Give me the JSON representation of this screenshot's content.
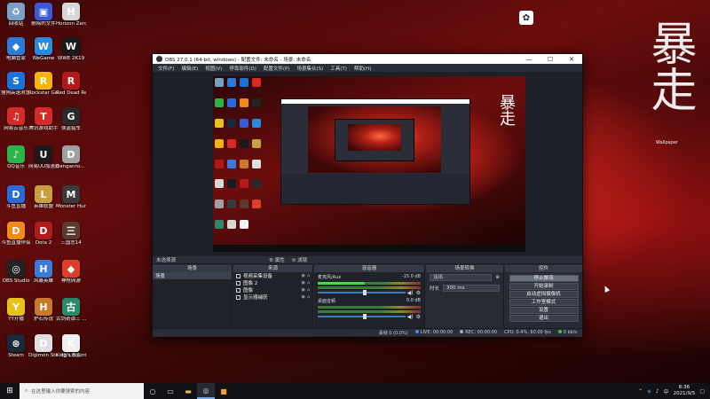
{
  "desktop": {
    "icons": [
      {
        "label": "回收站",
        "icon": "recycle-bin-icon",
        "color": "#7aa0c8",
        "glyph": "♻"
      },
      {
        "label": "电脑管家",
        "icon": "shield-icon",
        "color": "#2a7ad8",
        "glyph": "◆"
      },
      {
        "label": "搜狗高速浏览器",
        "icon": "browser-icon",
        "color": "#1a73d8",
        "glyph": "S"
      },
      {
        "label": "网易云音乐",
        "icon": "netease-music-icon",
        "color": "#d42a2a",
        "glyph": "♫"
      },
      {
        "label": "QQ音乐",
        "icon": "qq-music-icon",
        "color": "#2cb34a",
        "glyph": "♪"
      },
      {
        "label": "斗鱼直播",
        "icon": "douyu-icon",
        "color": "#2a6ad8",
        "glyph": "D"
      },
      {
        "label": "斗鱼直播伴侣",
        "icon": "douyu-companion-icon",
        "color": "#f08a1a",
        "glyph": "D"
      },
      {
        "label": "OBS Studio",
        "icon": "obs-icon",
        "color": "#222222",
        "glyph": "◎"
      },
      {
        "label": "YY开播",
        "icon": "yy-icon",
        "color": "#e8c21a",
        "glyph": "Y"
      },
      {
        "label": "Steam",
        "icon": "steam-icon",
        "color": "#1b2838",
        "glyph": "⊛"
      },
      {
        "label": "删除的文件",
        "icon": "folder-icon",
        "color": "#3a5ad8",
        "glyph": "▣"
      },
      {
        "label": "WeGame",
        "icon": "wegame-icon",
        "color": "#2a8ae0",
        "glyph": "W"
      },
      {
        "label": "Rockstar Games...",
        "icon": "rockstar-icon",
        "color": "#f5b400",
        "glyph": "R"
      },
      {
        "label": "腾讯游戏助手",
        "icon": "tencent-icon",
        "color": "#d42a2a",
        "glyph": "T"
      },
      {
        "label": "网易UU加速器",
        "icon": "uu-icon",
        "color": "#1a1a1a",
        "glyph": "U"
      },
      {
        "label": "英雄联盟",
        "icon": "lol-icon",
        "color": "#c8a040",
        "glyph": "L"
      },
      {
        "label": "Dota 2",
        "icon": "dota-icon",
        "color": "#b01a1a",
        "glyph": "D"
      },
      {
        "label": "风暴英雄",
        "icon": "hots-icon",
        "color": "#3a7ad8",
        "glyph": "H"
      },
      {
        "label": "炉石传说",
        "icon": "hearthstone-icon",
        "color": "#c87a2a",
        "glyph": "H"
      },
      {
        "label": "Digimon Story Cyb...",
        "icon": "digimon-icon",
        "color": "#e0e0e0",
        "glyph": "D"
      },
      {
        "label": "Horizon Zero Dawn",
        "icon": "horizon-icon",
        "color": "#d8d8d8",
        "glyph": "H"
      },
      {
        "label": "WWE 2K19",
        "icon": "wwe-icon",
        "color": "#1a1a1a",
        "glyph": "W"
      },
      {
        "label": "Red Dead Redempti...",
        "icon": "rdr-icon",
        "color": "#b01a1a",
        "glyph": "R"
      },
      {
        "label": "侠盗猎车",
        "icon": "gta-icon",
        "color": "#2a2a2a",
        "glyph": "G"
      },
      {
        "label": "Danganro... Trigger H...",
        "icon": "danganronpa-icon",
        "color": "#a0a0a0",
        "glyph": "D"
      },
      {
        "label": "Monster Hunter...",
        "icon": "monster-hunter-icon",
        "color": "#3a3a3a",
        "glyph": "M"
      },
      {
        "label": "三国志14",
        "icon": "sangokushi-icon",
        "color": "#5a3a2a",
        "glyph": "三"
      },
      {
        "label": "神枪网游",
        "icon": "game-icon",
        "color": "#d8402a",
        "glyph": "◆"
      },
      {
        "label": "古剑奇谭三 ...",
        "icon": "gujian-icon",
        "color": "#2a8a6a",
        "glyph": "古"
      },
      {
        "label": "超凡双生",
        "icon": "beyond-icon",
        "color": "#d8d8d8",
        "glyph": "B"
      },
      {
        "label": "King's Bounty II",
        "icon": "kings-bounty-icon",
        "color": "#f0f0f0",
        "glyph": "K"
      }
    ],
    "calligraphy": "暴走",
    "calligraphy_sub": "Wallpaper"
  },
  "obs": {
    "title": "OBS 27.0.1 (64-bit, windows) - 配置文件: 未命名 - 场景: 未命名",
    "menu": [
      "文件(F)",
      "编辑(E)",
      "视图(V)",
      "停靠部件(D)",
      "配置文件(P)",
      "场景集合(S)",
      "工具(T)",
      "帮助(H)"
    ],
    "scene_bar": {
      "label": "未选择源",
      "filters": [
        "属性",
        "滤镜"
      ]
    },
    "docks": {
      "scenes": {
        "title": "场景",
        "items": [
          "场景"
        ]
      },
      "sources": {
        "title": "来源",
        "items": [
          "视频采集设备",
          "图像 2",
          "图像",
          "显示器捕获"
        ]
      },
      "mixer": {
        "title": "混音器",
        "channels": [
          {
            "name": "麦克风/Aux",
            "db": "-15.0 dB",
            "active": true
          },
          {
            "name": "桌面音频",
            "db": "0.0 dB",
            "active": false
          }
        ]
      },
      "transitions": {
        "title": "场景转换",
        "type": "淡出",
        "duration_label": "时长",
        "duration": "300 ms"
      },
      "controls": {
        "title": "控件",
        "buttons": [
          "停止推流",
          "开始录制",
          "启动虚拟摄像机",
          "工作室模式",
          "设置",
          "退出"
        ]
      }
    },
    "status": {
      "live": "LIVE: 00:00:00",
      "rec": "REC: 00:00:00",
      "cpu": "CPU: 0.4%, 60.00 fps",
      "dropped": "丢帧 0 (0.0%)",
      "bitrate": "0 kb/s"
    }
  },
  "taskbar": {
    "search_placeholder": "在这里输入你要搜索的内容",
    "time": "8:36",
    "date": "2021/9/5",
    "apps": [
      "task-view-icon",
      "edge-icon",
      "file-explorer-icon",
      "obs-icon",
      "store-icon"
    ]
  }
}
